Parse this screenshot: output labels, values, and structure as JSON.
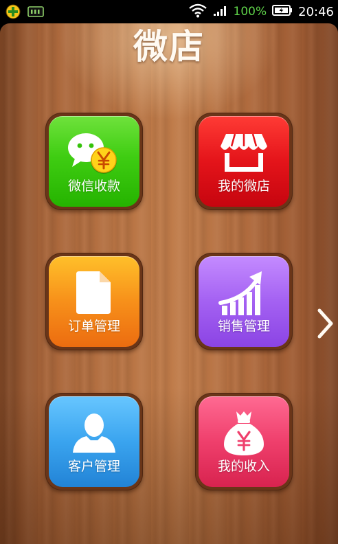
{
  "status_bar": {
    "notification_icons": [
      "app-notification-icon",
      "keyboard-notification-icon"
    ],
    "system_icons": [
      "wifi-icon",
      "signal-icon",
      "battery-icon"
    ],
    "battery_percent": "100%",
    "time": "20:46",
    "battery_color": "#5fd34a"
  },
  "app": {
    "title": "微店"
  },
  "tiles": [
    {
      "label": "微信收款",
      "icon": "wechat-payment-icon",
      "color": "#3fcd12"
    },
    {
      "label": "我的微店",
      "icon": "storefront-icon",
      "color": "#e4141a"
    },
    {
      "label": "订单管理",
      "icon": "document-icon",
      "color": "#f7901a"
    },
    {
      "label": "销售管理",
      "icon": "growth-chart-icon",
      "color": "#a461f2"
    },
    {
      "label": "客户管理",
      "icon": "user-icon",
      "color": "#3aa4ef"
    },
    {
      "label": "我的收入",
      "icon": "money-bag-icon",
      "color": "#ef3f6c"
    }
  ],
  "navigation": {
    "next_page_icon": "chevron-right-icon"
  }
}
